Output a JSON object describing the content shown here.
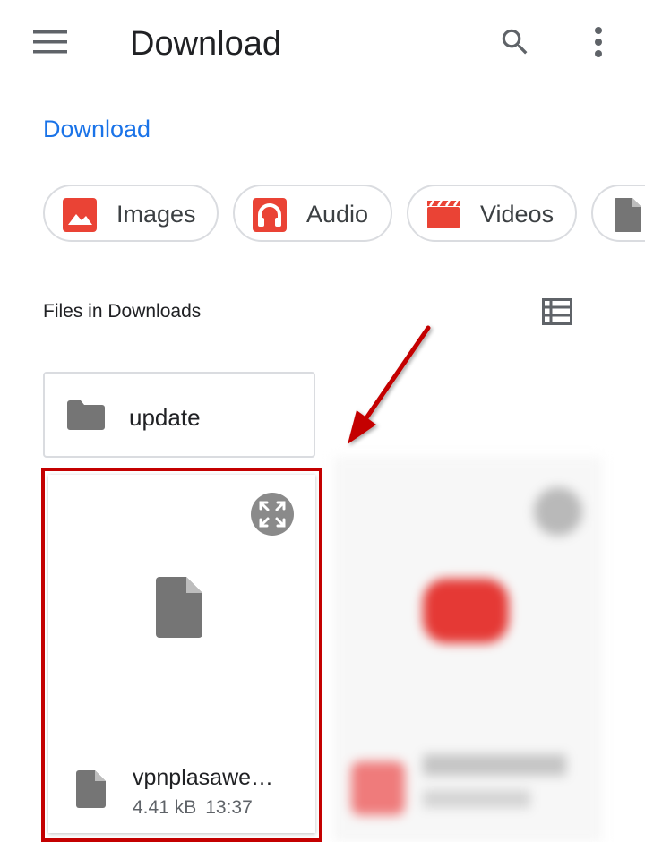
{
  "appbar": {
    "title": "Download",
    "menu_icon": "hamburger-menu-icon",
    "search_icon": "search-icon",
    "more_icon": "more-vert-icon"
  },
  "breadcrumb": {
    "label": "Download"
  },
  "chips": [
    {
      "label": "Images",
      "icon": "image-icon",
      "color": "#ea4335"
    },
    {
      "label": "Audio",
      "icon": "headphones-icon",
      "color": "#ea4335"
    },
    {
      "label": "Videos",
      "icon": "movie-clapper-icon",
      "color": "#ea4335"
    },
    {
      "label": "",
      "icon": "document-icon",
      "color": "#757575"
    }
  ],
  "section": {
    "title": "Files in Downloads",
    "view_toggle_icon": "list-view-icon"
  },
  "folders": [
    {
      "name": "update",
      "icon": "folder-icon"
    }
  ],
  "files": [
    {
      "name": "vpnplasawe…",
      "size": "4.41 kB",
      "time": "13:37",
      "icon": "file-icon",
      "expand_icon": "expand-icon"
    }
  ],
  "colors": {
    "accent": "#1a73e8",
    "highlight": "#c40000",
    "icon_gray": "#757575"
  }
}
